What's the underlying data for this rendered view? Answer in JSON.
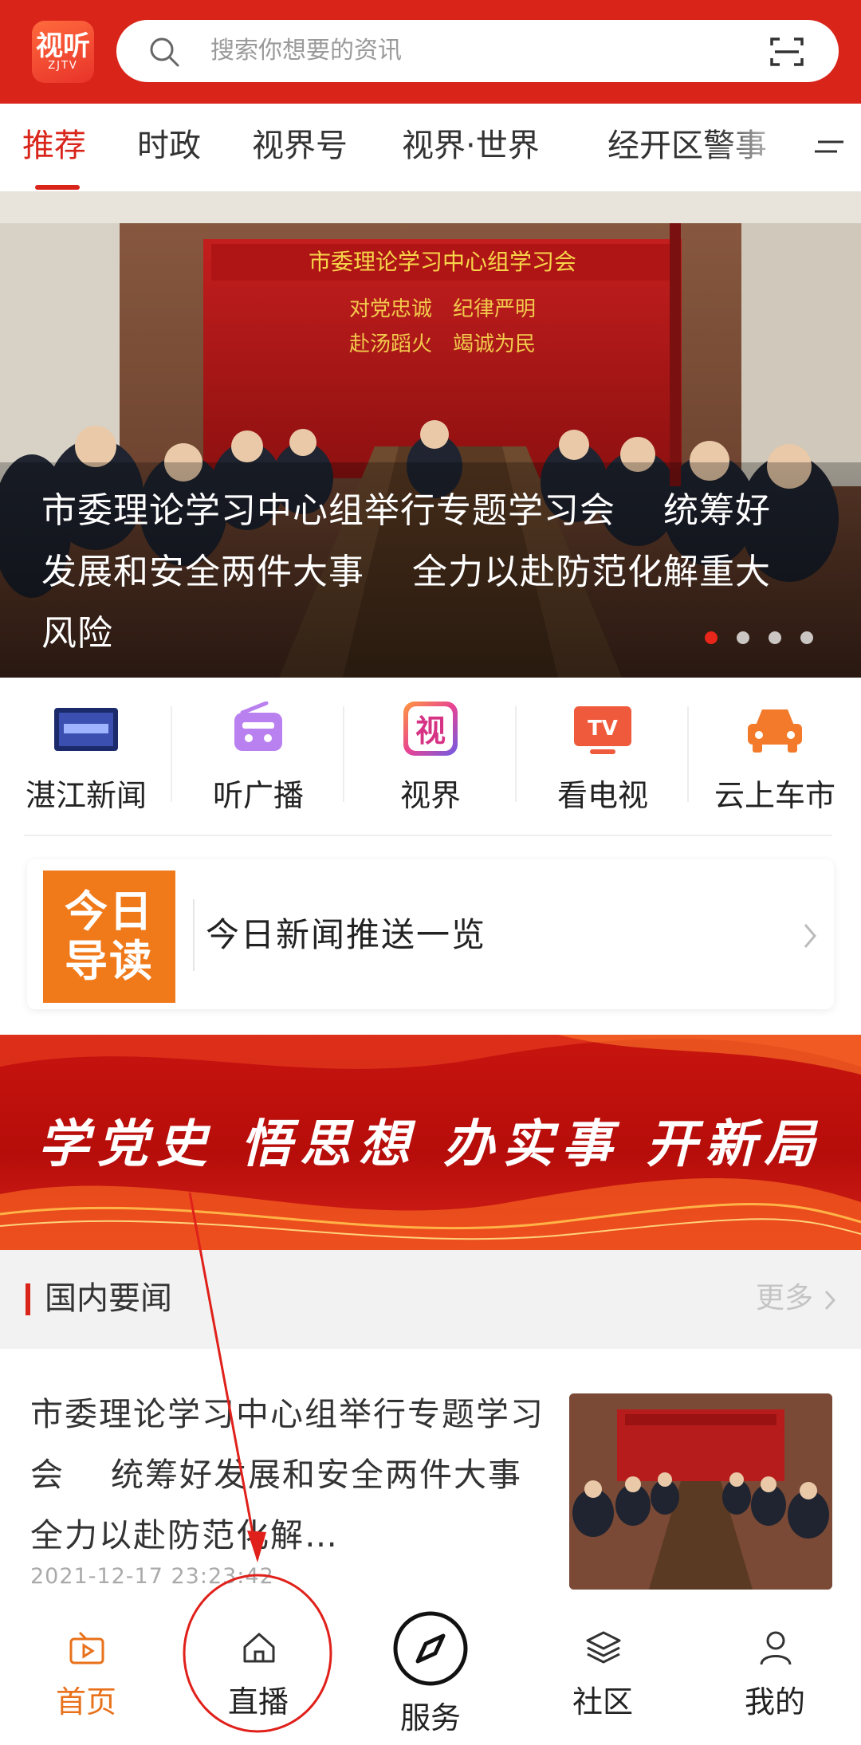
{
  "header": {
    "logo": {
      "main": "视听",
      "sub": "ZJTV"
    },
    "search_placeholder": "搜索你想要的资讯",
    "brand_color": "#d9241a"
  },
  "tabs": [
    {
      "label": "推荐",
      "active": true
    },
    {
      "label": "时政",
      "active": false
    },
    {
      "label": "视界号",
      "active": false
    },
    {
      "label": "视界·世界",
      "active": false
    },
    {
      "label": "经开区警事",
      "active": false
    }
  ],
  "banner": {
    "title": "市委理论学习中心组举行专题学习会　 统筹好发展和安全两件大事　 全力以赴防范化解重大风险",
    "photo_texts": {
      "headline": "市委理论学习中心组学习会",
      "line1": "对党忠诚　纪律严明",
      "line2": "赴汤蹈火　竭诚为民"
    },
    "slide_count": 4,
    "active_slide": 1
  },
  "shortcuts": [
    {
      "label": "湛江新闻",
      "icon": "zhanjiang-news-icon"
    },
    {
      "label": "听广播",
      "icon": "radio-icon"
    },
    {
      "label": "视界",
      "icon": "shijie-icon"
    },
    {
      "label": "看电视",
      "icon": "tv-icon"
    },
    {
      "label": "云上车市",
      "icon": "car-icon"
    }
  ],
  "today": {
    "badge_line1": "今日",
    "badge_line2": "导读",
    "text": "今日新闻推送一览"
  },
  "slogan": {
    "text": "学党史 悟思想 办实事 开新局"
  },
  "section": {
    "title": "国内要闻",
    "more": "更多"
  },
  "article": {
    "title": "市委理论学习中心组举行专题学习会　 统筹好发展和安全两件大事　 全力以赴防范化解…",
    "time": "2021-12-17 23:23:42"
  },
  "bottom_nav": [
    {
      "label": "首页",
      "icon": "video-home-icon",
      "active": true
    },
    {
      "label": "直播",
      "icon": "house-icon",
      "active": false
    },
    {
      "label": "服务",
      "icon": "compass-icon",
      "active": false
    },
    {
      "label": "社区",
      "icon": "layers-icon",
      "active": false
    },
    {
      "label": "我的",
      "icon": "person-icon",
      "active": false
    }
  ],
  "colors": {
    "accent": "#d9241a",
    "active_nav": "#e8711a",
    "today_badge": "#f07a1a"
  }
}
